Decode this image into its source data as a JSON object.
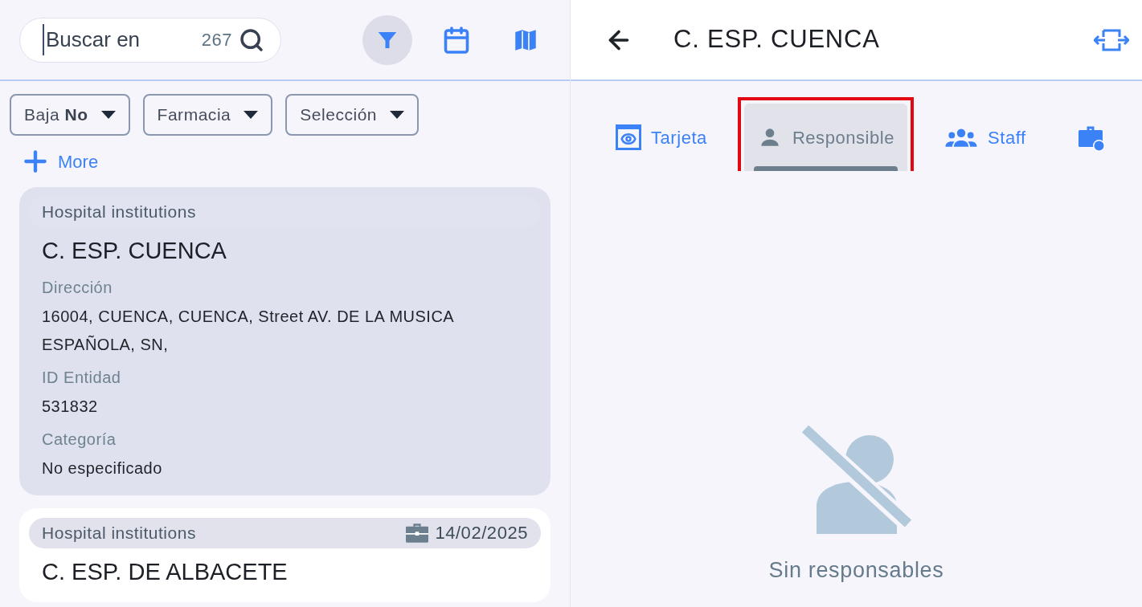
{
  "search": {
    "placeholder": "Buscar en",
    "count": "267"
  },
  "toolbar": [
    {
      "kind": "filter",
      "selected": true
    },
    {
      "kind": "calendar",
      "selected": false
    },
    {
      "kind": "map",
      "selected": false
    }
  ],
  "filters": [
    {
      "label": "Baja",
      "value": "No"
    },
    {
      "label": "Farmacia"
    },
    {
      "label": "Selección"
    }
  ],
  "more": "More",
  "cards": [
    {
      "category": "Hospital institutions",
      "selected": true,
      "name": "C. ESP. CUENCA",
      "fields": [
        {
          "label": "Dirección",
          "value": "16004, CUENCA, CUENCA, Street AV. DE LA MUSICA ESPAÑOLA, SN,"
        },
        {
          "label": "ID Entidad",
          "value": "531832"
        },
        {
          "label": "Categoría",
          "value": "No especificado"
        }
      ]
    },
    {
      "category": "Hospital institutions",
      "date": "14/02/2025",
      "selected": false,
      "name": "C. ESP. DE ALBACETE"
    }
  ],
  "detail": {
    "title": "C. ESP. CUENCA",
    "tabs": [
      {
        "kind": "card",
        "label": "Tarjeta",
        "selected": false,
        "highlighted": false
      },
      {
        "kind": "person",
        "label": "Responsible",
        "selected": true,
        "highlighted": true
      },
      {
        "kind": "group",
        "label": "Staff",
        "selected": false,
        "highlighted": false
      },
      {
        "kind": "briefcase",
        "selected": false,
        "highlighted": false
      }
    ],
    "empty_message": "Sin responsables"
  }
}
